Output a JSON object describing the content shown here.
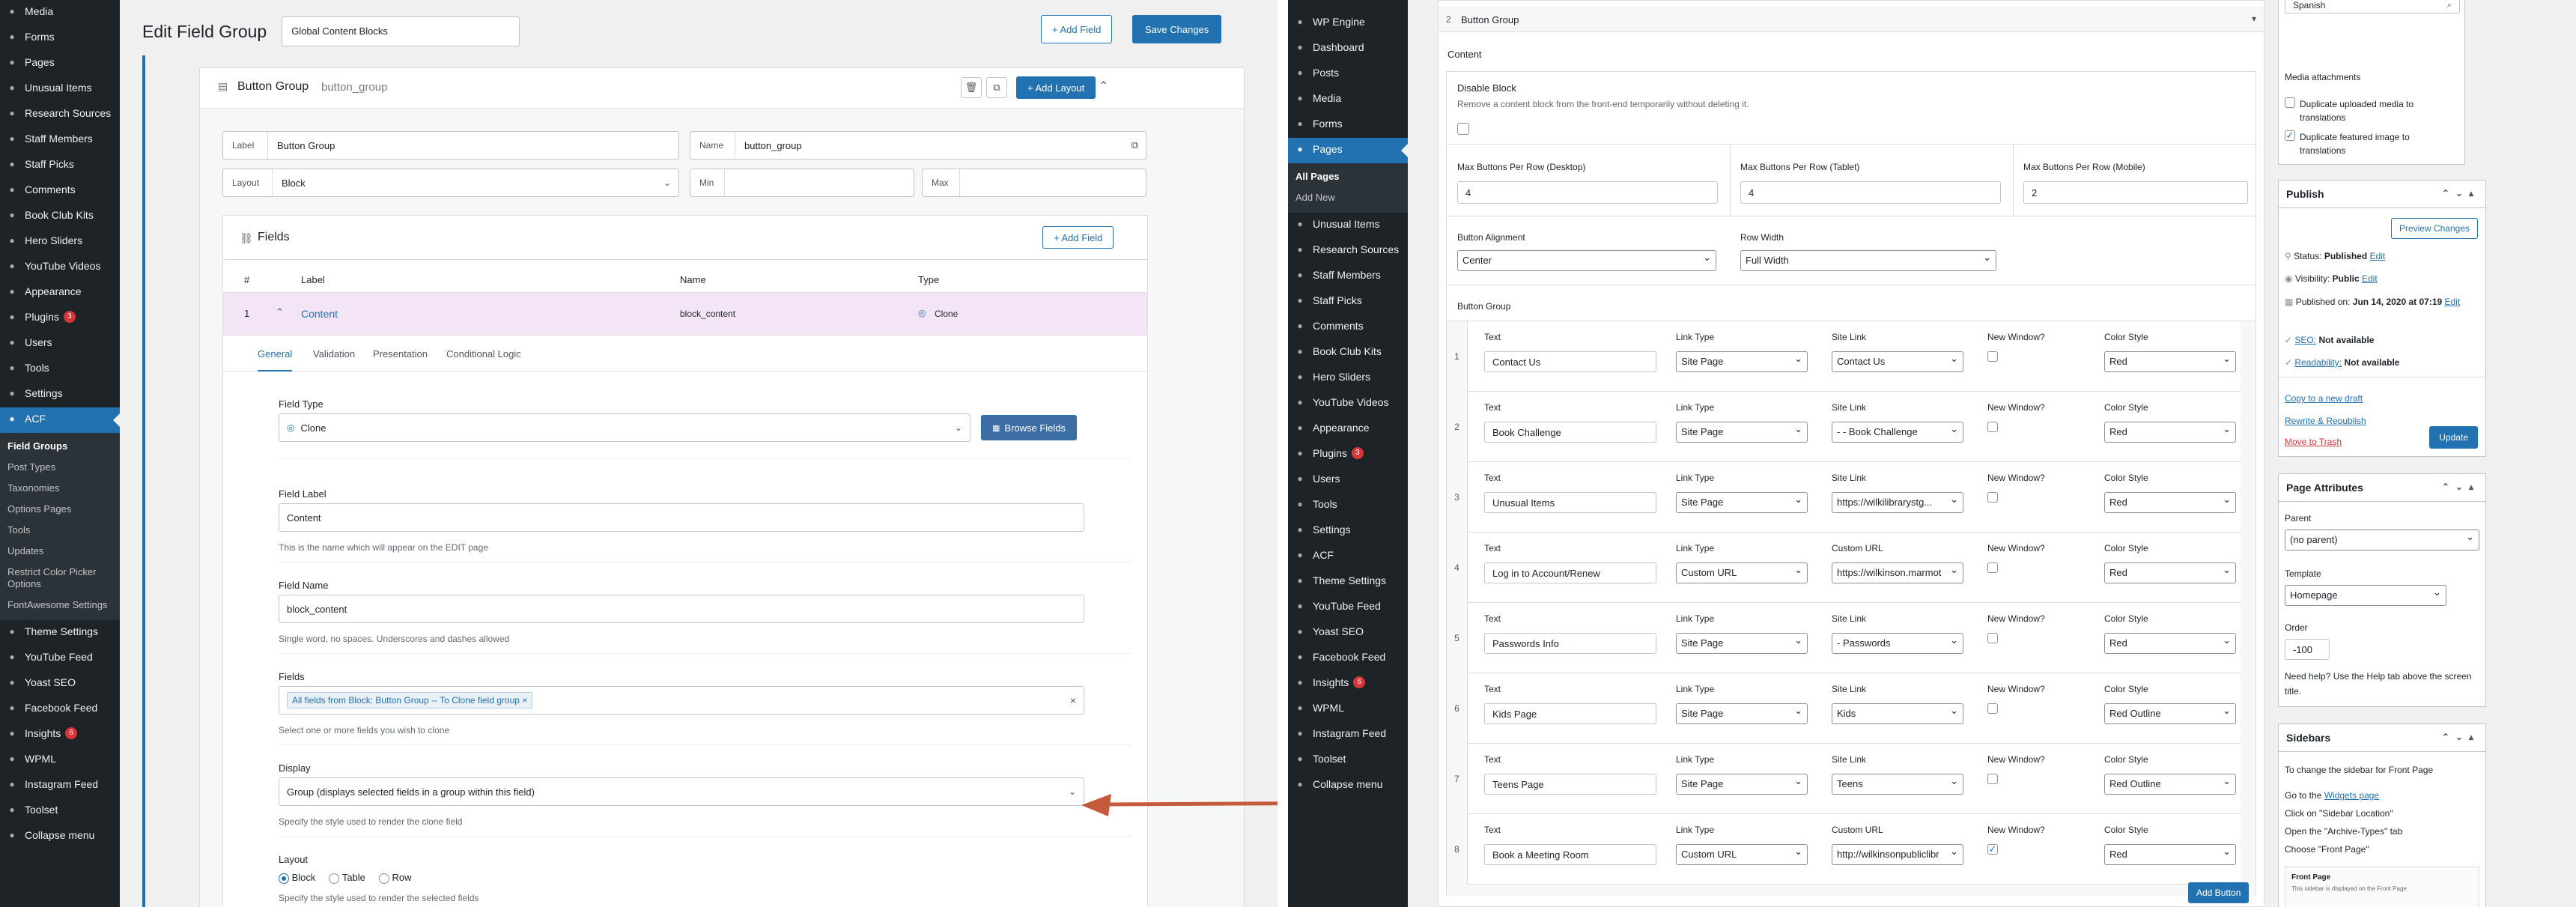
{
  "left": {
    "menu_top": [
      {
        "icon": "media-icon",
        "label": "Media"
      },
      {
        "icon": "forms-icon",
        "label": "Forms"
      },
      {
        "icon": "pages-icon",
        "label": "Pages"
      },
      {
        "icon": "unusual-items-icon",
        "label": "Unusual Items"
      },
      {
        "icon": "research-sources-icon",
        "label": "Research Sources"
      },
      {
        "icon": "staff-members-icon",
        "label": "Staff Members"
      },
      {
        "icon": "staff-picks-icon",
        "label": "Staff Picks"
      },
      {
        "icon": "comments-icon",
        "label": "Comments"
      },
      {
        "icon": "book-club-icon",
        "label": "Book Club Kits"
      },
      {
        "icon": "hero-sliders-icon",
        "label": "Hero Sliders"
      },
      {
        "icon": "youtube-icon",
        "label": "YouTube Videos"
      }
    ],
    "menu_mid": [
      {
        "icon": "appearance-icon",
        "label": "Appearance",
        "badge": ""
      },
      {
        "icon": "plugins-icon",
        "label": "Plugins",
        "badge": "3"
      },
      {
        "icon": "users-icon",
        "label": "Users",
        "badge": ""
      },
      {
        "icon": "tools-icon",
        "label": "Tools",
        "badge": ""
      },
      {
        "icon": "settings-icon",
        "label": "Settings",
        "badge": ""
      },
      {
        "icon": "acf-icon",
        "label": "ACF",
        "badge": ""
      }
    ],
    "acf_sub": [
      "Field Groups",
      "Post Types",
      "Taxonomies",
      "Options Pages",
      "Tools",
      "Updates",
      "Restrict Color Picker Options",
      "FontAwesome Settings"
    ],
    "menu_bottom": [
      {
        "icon": "theme-settings-icon",
        "label": "Theme Settings",
        "badge": ""
      },
      {
        "icon": "youtube-feed-icon",
        "label": "YouTube Feed",
        "badge": ""
      },
      {
        "icon": "yoast-icon",
        "label": "Yoast SEO",
        "badge": ""
      },
      {
        "icon": "facebook-feed-icon",
        "label": "Facebook Feed",
        "badge": ""
      },
      {
        "icon": "insights-icon",
        "label": "Insights",
        "badge": "6"
      },
      {
        "icon": "wpml-icon",
        "label": "WPML",
        "badge": ""
      },
      {
        "icon": "instagram-feed-icon",
        "label": "Instagram Feed",
        "badge": ""
      },
      {
        "icon": "toolset-icon",
        "label": "Toolset",
        "badge": ""
      },
      {
        "icon": "collapse-icon",
        "label": "Collapse menu",
        "badge": ""
      }
    ],
    "page_title": "Edit Field Group",
    "group_title": "Global Content Blocks",
    "add_field": "+ Add Field",
    "save_changes": "Save Changes",
    "layout_header": {
      "label": "Button Group",
      "name": "button_group",
      "add_layout": "+ Add Layout"
    },
    "label_field": {
      "label": "Label",
      "value": "Button Group"
    },
    "name_field": {
      "label": "Name",
      "value": "button_group"
    },
    "layout_field": {
      "label": "Layout",
      "value": "Block"
    },
    "min_label": "Min",
    "max_label": "Max",
    "fields_title": "Fields",
    "fields_add": "+ Add Field",
    "table_cols": [
      "#",
      "Label",
      "Name",
      "Type"
    ],
    "row": {
      "num": "1",
      "label": "Content",
      "name": "block_content",
      "type": "Clone"
    },
    "tabs": [
      "General",
      "Validation",
      "Presentation",
      "Conditional Logic"
    ],
    "field_type": {
      "label": "Field Type",
      "value": "Clone",
      "browse": "Browse Fields"
    },
    "field_label": {
      "label": "Field Label",
      "value": "Content",
      "help": "This is the name which will appear on the EDIT page"
    },
    "field_name": {
      "label": "Field Name",
      "value": "block_content",
      "help": "Single word, no spaces. Underscores and dashes allowed"
    },
    "fields_select": {
      "label": "Fields",
      "tag": "All fields from Block: Button Group -- To Clone field group",
      "help": "Select one or more fields you wish to clone"
    },
    "display": {
      "label": "Display",
      "value": "Group (displays selected fields in a group within this field)",
      "help": "Specify the style used to render the clone field"
    },
    "layout_radio": {
      "label": "Layout",
      "options": [
        "Block",
        "Table",
        "Row"
      ],
      "help": "Specify the style used to render the selected fields"
    }
  },
  "right": {
    "menu": [
      {
        "icon": "wpengine-icon",
        "label": "WP Engine",
        "badge": ""
      },
      {
        "icon": "dashboard-icon",
        "label": "Dashboard",
        "badge": ""
      },
      {
        "icon": "posts-icon",
        "label": "Posts",
        "badge": ""
      },
      {
        "icon": "media-icon",
        "label": "Media",
        "badge": ""
      },
      {
        "icon": "forms-icon",
        "label": "Forms",
        "badge": ""
      },
      {
        "icon": "pages-icon",
        "label": "Pages",
        "badge": ""
      }
    ],
    "pages_sub": [
      "All Pages",
      "Add New"
    ],
    "menu2": [
      {
        "icon": "unusual-items-icon",
        "label": "Unusual Items",
        "badge": ""
      },
      {
        "icon": "research-sources-icon",
        "label": "Research Sources",
        "badge": ""
      },
      {
        "icon": "staff-members-icon",
        "label": "Staff Members",
        "badge": ""
      },
      {
        "icon": "staff-picks-icon",
        "label": "Staff Picks",
        "badge": ""
      },
      {
        "icon": "comments-icon",
        "label": "Comments",
        "badge": ""
      },
      {
        "icon": "book-club-icon",
        "label": "Book Club Kits",
        "badge": ""
      },
      {
        "icon": "hero-sliders-icon",
        "label": "Hero Sliders",
        "badge": ""
      },
      {
        "icon": "youtube-icon",
        "label": "YouTube Videos",
        "badge": ""
      },
      {
        "icon": "appearance-icon",
        "label": "Appearance",
        "badge": ""
      },
      {
        "icon": "plugins-icon",
        "label": "Plugins",
        "badge": "3"
      },
      {
        "icon": "users-icon",
        "label": "Users",
        "badge": ""
      },
      {
        "icon": "tools-icon",
        "label": "Tools",
        "badge": ""
      },
      {
        "icon": "settings-icon",
        "label": "Settings",
        "badge": ""
      },
      {
        "icon": "acf-icon",
        "label": "ACF",
        "badge": ""
      },
      {
        "icon": "theme-settings-icon",
        "label": "Theme Settings",
        "badge": ""
      },
      {
        "icon": "youtube-feed-icon",
        "label": "YouTube Feed",
        "badge": ""
      },
      {
        "icon": "yoast-icon",
        "label": "Yoast SEO",
        "badge": ""
      },
      {
        "icon": "facebook-feed-icon",
        "label": "Facebook Feed",
        "badge": ""
      },
      {
        "icon": "insights-icon",
        "label": "Insights",
        "badge": "6"
      },
      {
        "icon": "wpml-icon",
        "label": "WPML",
        "badge": ""
      },
      {
        "icon": "instagram-feed-icon",
        "label": "Instagram Feed",
        "badge": ""
      },
      {
        "icon": "toolset-icon",
        "label": "Toolset",
        "badge": ""
      },
      {
        "icon": "collapse-icon",
        "label": "Collapse menu",
        "badge": ""
      }
    ],
    "block_num": "2",
    "block_title": "Button Group",
    "content_tab": "Content",
    "disable_block": {
      "label": "Disable Block",
      "help": "Remove a content block from the front-end temporarily without deleting it."
    },
    "max_desktop": {
      "label": "Max Buttons Per Row (Desktop)",
      "value": "4"
    },
    "max_tablet": {
      "label": "Max Buttons Per Row (Tablet)",
      "value": "4"
    },
    "max_mobile": {
      "label": "Max Buttons Per Row (Mobile)",
      "value": "2"
    },
    "alignment": {
      "label": "Button Alignment",
      "value": "Center"
    },
    "row_width": {
      "label": "Row Width",
      "value": "Full Width"
    },
    "button_group_label": "Button Group",
    "col_labels": {
      "text": "Text",
      "link_type": "Link Type",
      "site_link": "Site Link",
      "custom_url": "Custom URL",
      "new_window": "New Window?",
      "color_style": "Color Style"
    },
    "rows": [
      {
        "num": "1",
        "text": "Contact Us",
        "link_type": "Site Page",
        "link_label": "Site Link",
        "link": "Contact Us",
        "new_window": false,
        "color": "Red"
      },
      {
        "num": "2",
        "text": "Book Challenge",
        "link_type": "Site Page",
        "link_label": "Site Link",
        "link": "- - Book Challenge",
        "new_window": false,
        "color": "Red"
      },
      {
        "num": "3",
        "text": "Unusual Items",
        "link_type": "Site Page",
        "link_label": "Site Link",
        "link": "https://wilkilibrarystg...",
        "new_window": false,
        "color": "Red"
      },
      {
        "num": "4",
        "text": "Log in to Account/Renew",
        "link_type": "Custom URL",
        "link_label": "Custom URL",
        "link": "https://wilkinson.marmot",
        "new_window": false,
        "color": "Red"
      },
      {
        "num": "5",
        "text": "Passwords Info",
        "link_type": "Site Page",
        "link_label": "Site Link",
        "link": "- Passwords",
        "new_window": false,
        "color": "Red"
      },
      {
        "num": "6",
        "text": "Kids Page",
        "link_type": "Site Page",
        "link_label": "Site Link",
        "link": "Kids",
        "new_window": false,
        "color": "Red Outline"
      },
      {
        "num": "7",
        "text": "Teens Page",
        "link_type": "Site Page",
        "link_label": "Site Link",
        "link": "Teens",
        "new_window": false,
        "color": "Red Outline"
      },
      {
        "num": "8",
        "text": "Book a Meeting Room",
        "link_type": "Custom URL",
        "link_label": "Custom URL",
        "link": "http://wilkinsonpubliclibr",
        "new_window": true,
        "color": "Red"
      }
    ],
    "add_button": "Add Button",
    "language_value": "Spanish",
    "media_attachments": {
      "title": "Media attachments",
      "opt1": "Duplicate uploaded media to translations",
      "opt2": "Duplicate featured image to translations"
    },
    "publish": {
      "title": "Publish",
      "preview": "Preview Changes",
      "status_label": "Status:",
      "status": "Published",
      "visibility_label": "Visibility:",
      "visibility": "Public",
      "published_label": "Published on:",
      "published": "Jun 14, 2020 at 07:19",
      "edit": "Edit",
      "seo_label": "SEO:",
      "seo": "Not available",
      "readability_label": "Readability:",
      "readability": "Not available",
      "copy": "Copy to a new draft",
      "rewrite": "Rewrite & Republish",
      "trash": "Move to Trash",
      "update": "Update"
    },
    "page_attributes": {
      "title": "Page Attributes",
      "parent_label": "Parent",
      "parent": "(no parent)",
      "template_label": "Template",
      "template": "Homepage",
      "order_label": "Order",
      "order": "-100",
      "help": "Need help? Use the Help tab above the screen title."
    },
    "sidebars": {
      "title": "Sidebars",
      "intro": "To change the sidebar for Front Page",
      "go_pre": "Go to the",
      "go_link": "Widgets page",
      "step2": "Click on \"Sidebar Location\"",
      "step3": "Open the \"Archive-Types\" tab",
      "step4": "Choose \"Front Page\"",
      "thumb_title": "Front Page",
      "thumb_text": "This sidebar is displayed on the Front Page"
    }
  }
}
